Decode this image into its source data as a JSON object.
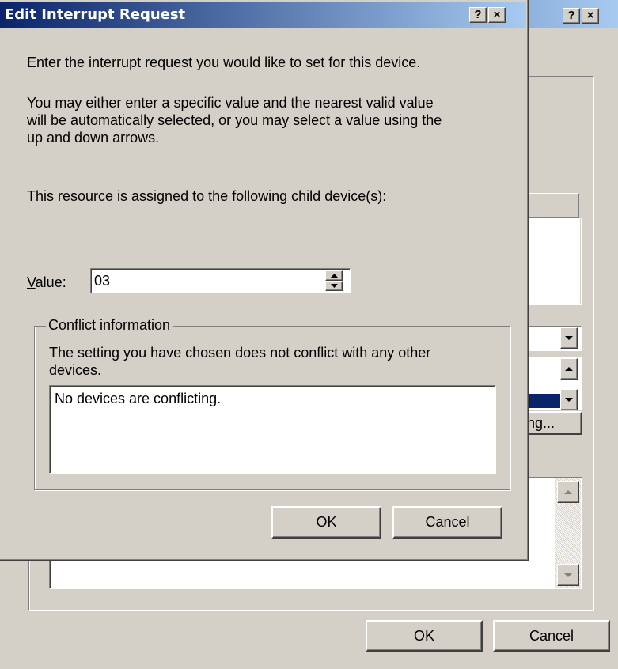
{
  "background_window": {
    "help_button": "?",
    "close_button": "×",
    "ok_label": "OK",
    "cancel_label": "Cancel",
    "partial_button_label": "ng..."
  },
  "dialog": {
    "title": "Edit Interrupt Request",
    "help_button": "?",
    "close_button": "×",
    "instruction": "Enter the interrupt request you would like to set for this device.",
    "explanation_lines": [
      "You may either enter a specific value and the nearest valid value",
      "will be automatically selected, or you may select a value using the",
      "up and down arrows."
    ],
    "assigned_text": "This resource is assigned to the following child device(s):",
    "value_label": "Value:",
    "value_input": "03",
    "conflict_group_label": "Conflict information",
    "conflict_message_lines": [
      "The setting you have chosen does not conflict with any other",
      "devices."
    ],
    "conflict_list_text": "No devices are conflicting.",
    "ok_label": "OK",
    "cancel_label": "Cancel"
  },
  "colors": {
    "titlebar_start": "#0a246a",
    "titlebar_end": "#a6caf0",
    "face": "#d4d0c8",
    "selection": "#0a246a"
  },
  "icons": [
    "help-icon",
    "close-icon",
    "spin-up-icon",
    "spin-down-icon",
    "dropdown-arrow-icon",
    "scroll-up-icon",
    "scroll-down-icon"
  ]
}
